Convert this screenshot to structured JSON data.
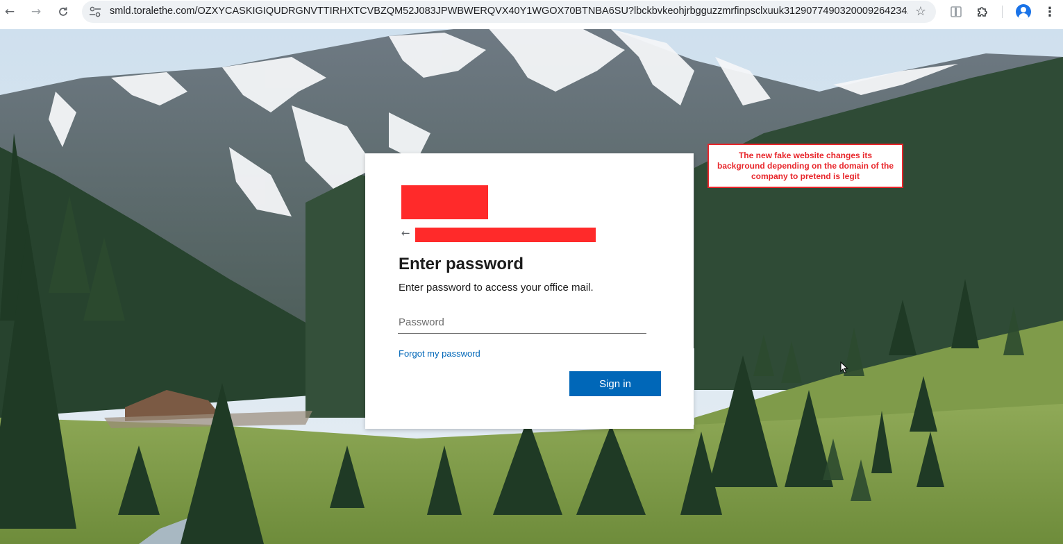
{
  "browser": {
    "url": "smld.toralethe.com/OZXYCASKIGIQUDRGNVTTIRHXTCVBZQM52J083JPWBWERQVX40Y1WGOX70BTNBA6SU?lbckbvkeohjrbgguzzmrfinpsclxuuk312907749032000926423​4...",
    "back_icon": "arrow-left",
    "forward_icon": "arrow-right",
    "reload_icon": "reload",
    "site_info_icon": "tune",
    "bookmark_icon": "star-outline",
    "extension_icon": "puzzle-piece",
    "reading_icon": "sidebar",
    "profile_icon": "person",
    "menu_icon": "three-dots-vertical"
  },
  "login": {
    "title": "Enter password",
    "subtitle": "Enter password to access your office mail.",
    "password_placeholder": "Password",
    "forgot_link": "Forgot my password",
    "signin_label": "Sign in",
    "accent_color": "#0067b8",
    "redaction_color": "#ff2a2a"
  },
  "annotation": {
    "text": "The new fake website changes its background depending on the domain of the company to pretend is legit",
    "color": "#e8262b"
  }
}
